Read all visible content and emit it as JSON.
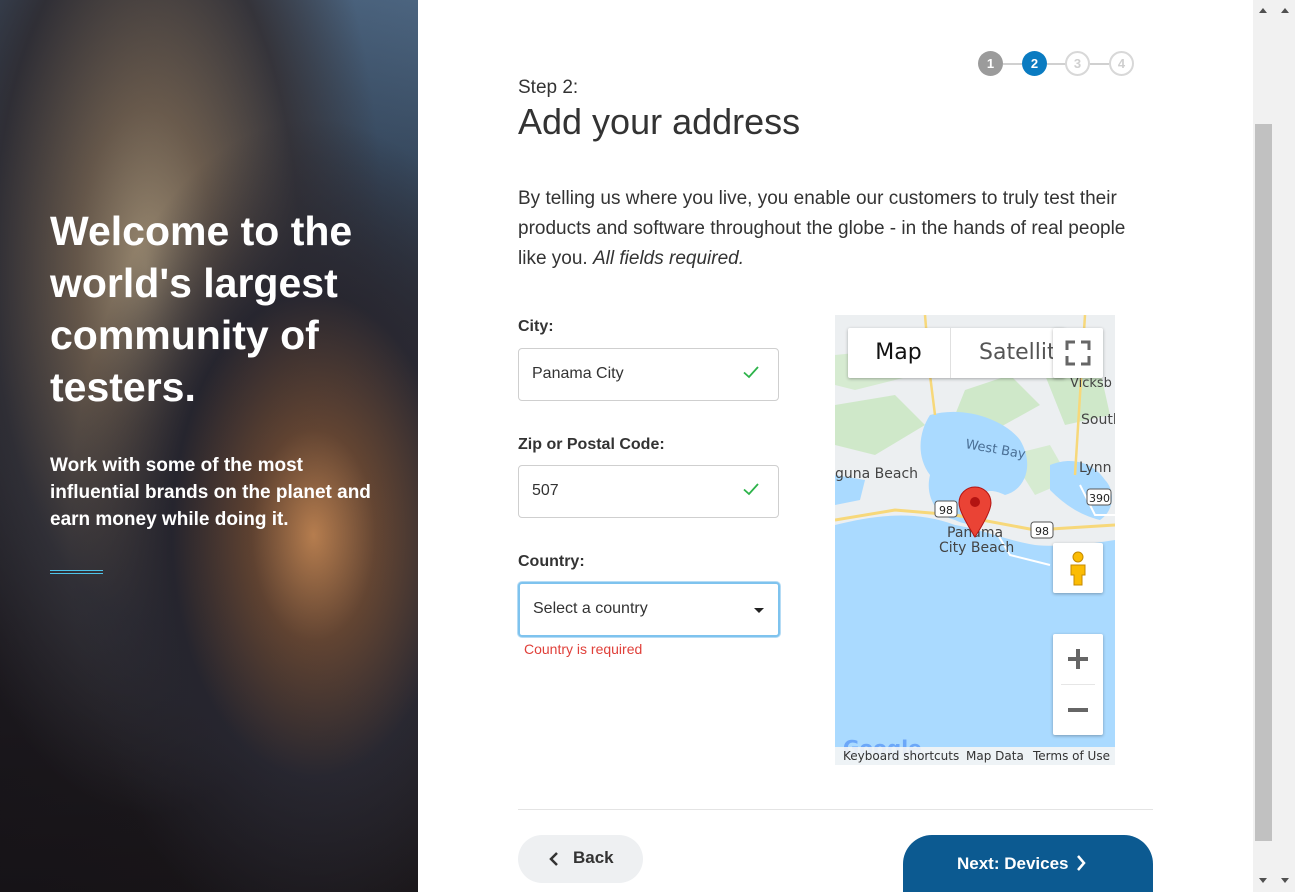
{
  "hero": {
    "title": "Welcome to the world's largest community of testers.",
    "subtitle": "Work with some of the most influential brands on the planet and earn money while doing it."
  },
  "stepper": {
    "steps": [
      "1",
      "2",
      "3",
      "4"
    ],
    "current": 2
  },
  "form": {
    "step_label": "Step 2:",
    "title": "Add your address",
    "intro": "By telling us where you live, you enable our customers to truly test their products and software throughout the globe - in the hands of real people like you.",
    "intro_note": "All fields required.",
    "city_label": "City:",
    "city_value": "Panama City",
    "zip_label": "Zip or Postal Code:",
    "zip_value": "507",
    "country_label": "Country:",
    "country_value": "Select a country",
    "country_error": "Country is required"
  },
  "map": {
    "type_map": "Map",
    "type_satellite": "Satellite",
    "places": {
      "west_bay": "West Bay",
      "laguna_beach": "guna Beach",
      "panama_city_beach_1": "Panama",
      "panama_city_beach_2": "City Beach",
      "vicksburg": "Vicksb",
      "south": "South",
      "lynn": "Lynn",
      "hwy98a": "98",
      "hwy98b": "98",
      "hwy390": "390"
    },
    "footer": {
      "shortcuts": "Keyboard shortcuts",
      "map_data": "Map Data",
      "terms": "Terms of Use"
    }
  },
  "actions": {
    "back": "Back",
    "next": "Next: Devices"
  },
  "colors": {
    "accent": "#0a7bc1",
    "next_button": "#0c5a91",
    "error": "#e0403a",
    "success": "#2db34a"
  }
}
